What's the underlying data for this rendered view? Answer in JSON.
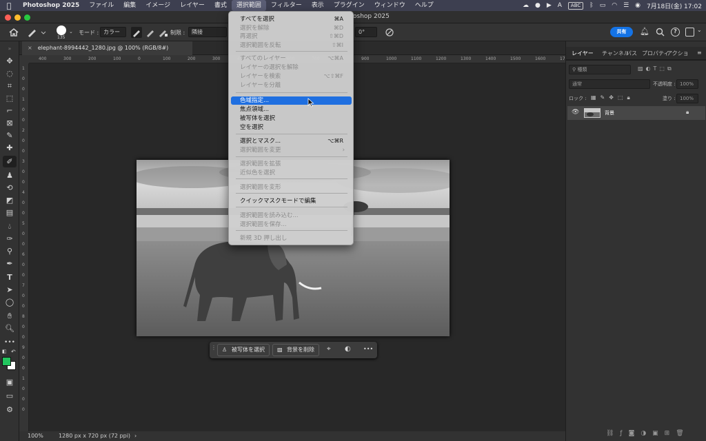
{
  "menubar": {
    "app_name": "Photoshop 2025",
    "items": [
      "ファイル",
      "編集",
      "イメージ",
      "レイヤー",
      "書式",
      "選択範囲",
      "フィルター",
      "表示",
      "プラグイン",
      "ウィンドウ",
      "ヘルプ"
    ],
    "active_index": 5,
    "input_mode": "ABC",
    "datetime": "7月18日(金) 17:02"
  },
  "window": {
    "title": "oshop 2025"
  },
  "options_bar": {
    "brush_size": "135",
    "mode_label": "モード :",
    "mode_value": "カラー",
    "limit_label": "制限 :",
    "limit_value": "隣接",
    "angle_value": "0°",
    "share_label": "共有"
  },
  "document": {
    "tab_title": "elephant-8994442_1280.jpg @ 100% (RGB/8#)",
    "close_glyph": "×",
    "zoom": "100%",
    "info": "1280 px x 720 px (72 ppi)",
    "status_arrow": "›"
  },
  "ruler": {
    "h_ticks": [
      "400",
      "300",
      "200",
      "100",
      "0",
      "100",
      "200",
      "300",
      "400",
      "500",
      "600",
      "700",
      "800",
      "900",
      "1000",
      "1100",
      "1200",
      "1300",
      "1400",
      "1500",
      "1600",
      "170"
    ],
    "v_ticks": [
      "1",
      "0",
      "0",
      "1",
      "0",
      "0",
      "2",
      "0",
      "0",
      "3",
      "0",
      "0",
      "4",
      "0",
      "0",
      "5",
      "0",
      "0",
      "6",
      "0",
      "0",
      "7",
      "0",
      "0",
      "8",
      "0",
      "0",
      "9",
      "0",
      "0",
      "1",
      "0",
      "0",
      "0"
    ]
  },
  "selection_menu": {
    "items": [
      {
        "label": "すべてを選択",
        "shortcut": "⌘A",
        "enabled": true
      },
      {
        "label": "選択を解除",
        "shortcut": "⌘D",
        "enabled": false
      },
      {
        "label": "再選択",
        "shortcut": "⇧⌘D",
        "enabled": false
      },
      {
        "label": "選択範囲を反転",
        "shortcut": "⇧⌘I",
        "enabled": false
      },
      {
        "label": "すべてのレイヤー",
        "shortcut": "⌥⌘A",
        "enabled": false
      },
      {
        "label": "レイヤーの選択を解除",
        "shortcut": "",
        "enabled": false
      },
      {
        "label": "レイヤーを検索",
        "shortcut": "⌥⇧⌘F",
        "enabled": false
      },
      {
        "label": "レイヤーを分離",
        "shortcut": "",
        "enabled": false
      },
      {
        "label": "色域指定...",
        "shortcut": "",
        "enabled": true,
        "highlighted": true
      },
      {
        "label": "焦点領域...",
        "shortcut": "",
        "enabled": true
      },
      {
        "label": "被写体を選択",
        "shortcut": "",
        "enabled": true
      },
      {
        "label": "空を選択",
        "shortcut": "",
        "enabled": true
      },
      {
        "label": "選択とマスク...",
        "shortcut": "⌥⌘R",
        "enabled": true
      },
      {
        "label": "選択範囲を変更",
        "shortcut": "",
        "enabled": false,
        "submenu": true
      },
      {
        "label": "選択範囲を拡張",
        "shortcut": "",
        "enabled": false
      },
      {
        "label": "近似色を選択",
        "shortcut": "",
        "enabled": false
      },
      {
        "label": "選択範囲を変形",
        "shortcut": "",
        "enabled": false
      },
      {
        "label": "クイックマスクモードで編集",
        "shortcut": "",
        "enabled": true
      },
      {
        "label": "選択範囲を読み込む...",
        "shortcut": "",
        "enabled": false
      },
      {
        "label": "選択範囲を保存...",
        "shortcut": "",
        "enabled": false
      },
      {
        "label": "新規 3D 押し出し",
        "shortcut": "",
        "enabled": false
      }
    ]
  },
  "taskbar": {
    "select_subject": "被写体を選択",
    "remove_background": "背景を削除",
    "more": "•••"
  },
  "right_panel": {
    "tabs": [
      "レイヤー",
      "チャンネル",
      "パス",
      "プロパティ",
      "アクショ"
    ],
    "active_tab": 0,
    "filter_label": "種類",
    "blend_mode": "通常",
    "opacity_label": "不透明度 :",
    "opacity_value": "100%",
    "lock_label": "ロック :",
    "fill_label": "塗り :",
    "fill_value": "100%",
    "layer_name": "背景"
  },
  "colors": {
    "foreground": "#22c55e",
    "background": "#ffffff",
    "accent": "#1473e6",
    "menu_highlight": "#1f6fe0"
  }
}
